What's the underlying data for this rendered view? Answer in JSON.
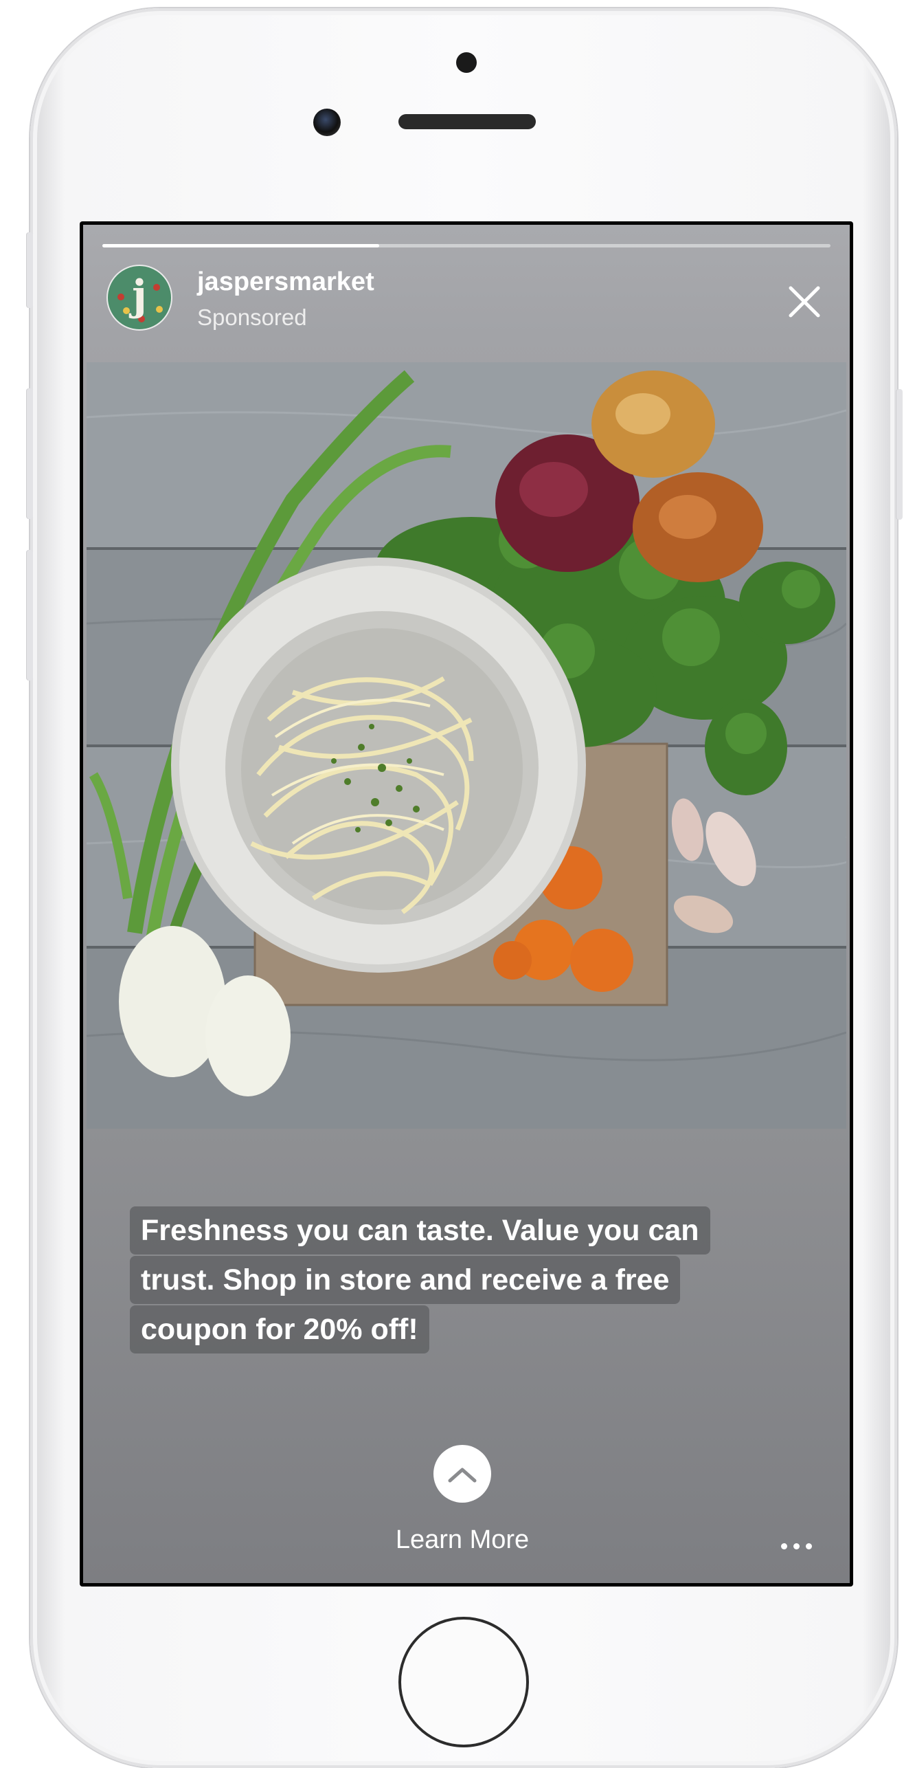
{
  "story": {
    "account_name": "jaspersmarket",
    "label": "Sponsored",
    "progress": 0.38,
    "caption_lines": [
      "Freshness you can taste. Value you can",
      "trust. Shop in store and receive a free",
      "coupon for 20% off!"
    ],
    "cta_label": "Learn More",
    "avatar_letter": "j"
  },
  "icons": {
    "close": "close-icon",
    "cta": "chevron-up-icon",
    "more": "more-dots-icon"
  },
  "colors": {
    "avatar_bg": "#4c8c6a",
    "overlay_gray": "#9a9b9f"
  }
}
